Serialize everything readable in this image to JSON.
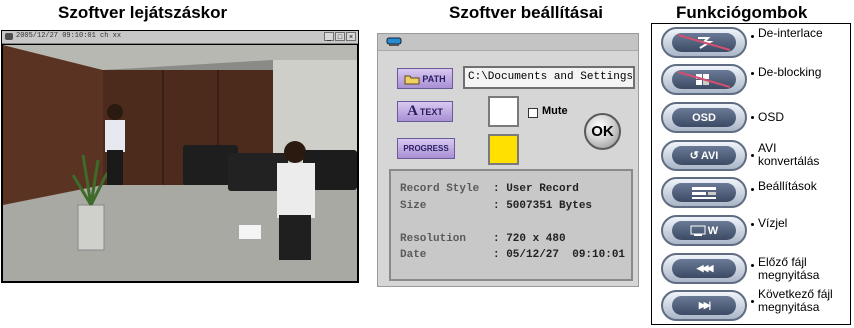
{
  "headings": {
    "playback": "Szoftver lejátszáskor",
    "settings": "Szoftver beállításai",
    "functions": "Funkciógombok"
  },
  "player": {
    "title": "2005/12/27 09:10:01 ch xx",
    "buttons": {
      "minimize": "_",
      "maximize": "□",
      "close": "×"
    }
  },
  "settings": {
    "path_button": "PATH",
    "text_button": "TEXT",
    "text_button_letter": "A",
    "progress_button": "PROGRESS",
    "path_value": "C:\\Documents and Settings\\",
    "mute_label": "Mute",
    "mute_checked": false,
    "ok_label": "OK",
    "text_color": "#ffffff",
    "progress_color": "#ffe000",
    "info": [
      {
        "label": "Record Style",
        "value": ": User Record"
      },
      {
        "label": "Size",
        "value": ": 5007351 Bytes"
      },
      {
        "label": "Resolution",
        "value": ": 720 x 480"
      },
      {
        "label": "Date",
        "value": ": 05/12/27  09:10:01"
      }
    ]
  },
  "functions": [
    {
      "icon": "de-interlace-icon",
      "label": "De-interlace"
    },
    {
      "icon": "de-blocking-icon",
      "label": "De-blocking"
    },
    {
      "icon": "osd-icon",
      "label": "OSD",
      "glyph": "OSD"
    },
    {
      "icon": "avi-convert-icon",
      "label": "AVI konvertálás",
      "label_line1": "AVI",
      "label_line2": "konvertálás",
      "glyph": "AVI"
    },
    {
      "icon": "settings-icon",
      "label": "Beállítások"
    },
    {
      "icon": "watermark-icon",
      "label": "Vízjel",
      "glyph": "W"
    },
    {
      "icon": "previous-file-icon",
      "label": "Előző fájl megnyitása",
      "label_line1": "Előző fájl",
      "label_line2": "megnyitása",
      "glyph": "◀◀◀"
    },
    {
      "icon": "next-file-icon",
      "label": "Következő fájl megnyitása",
      "label_line1": "Következő fájl",
      "label_line2": "megnyitása",
      "glyph": "▶▶|"
    }
  ]
}
